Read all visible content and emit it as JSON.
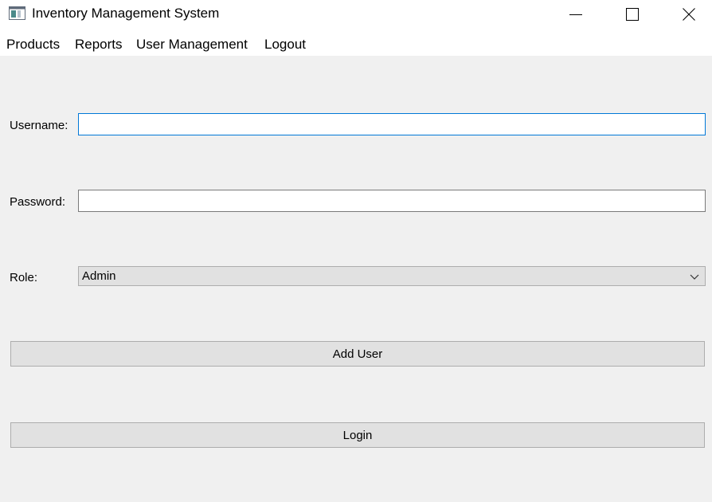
{
  "window": {
    "title": "Inventory Management System",
    "icon": "app-window-icon",
    "controls": {
      "minimize_icon": "minimize-icon",
      "maximize_icon": "maximize-icon",
      "close_icon": "close-icon"
    }
  },
  "menu": {
    "items": [
      {
        "label": "Products"
      },
      {
        "label": "Reports"
      },
      {
        "label": "User Management"
      },
      {
        "label": "Logout"
      }
    ]
  },
  "form": {
    "username": {
      "label": "Username:",
      "value": "",
      "focused": true
    },
    "password": {
      "label": "Password:",
      "value": ""
    },
    "role": {
      "label": "Role:",
      "selected": "Admin",
      "icon": "chevron-down-icon"
    },
    "add_user_label": "Add User",
    "login_label": "Login"
  },
  "colors": {
    "content_background": "#f0f0f0",
    "focus_border": "#0078d7",
    "button_background": "#e1e1e1"
  }
}
